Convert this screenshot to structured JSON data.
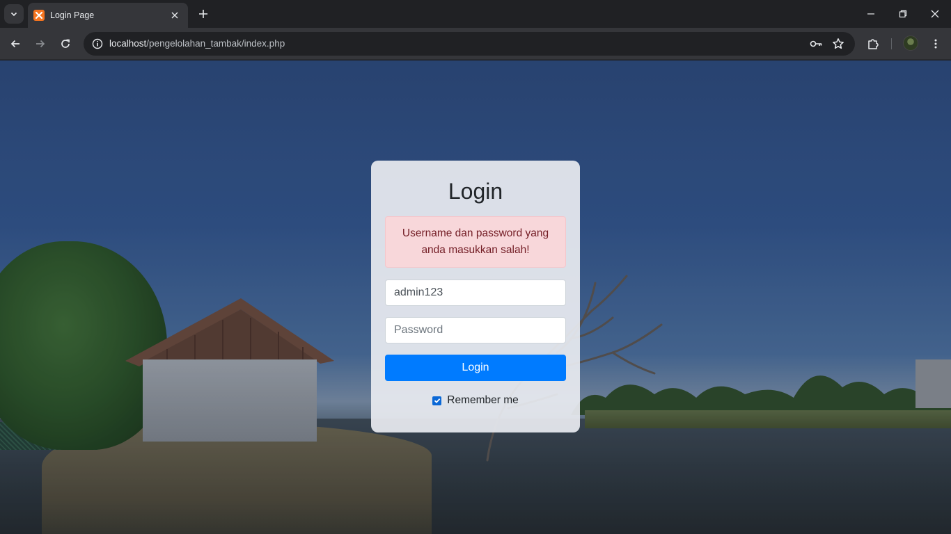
{
  "browser": {
    "tab": {
      "title": "Login Page",
      "favicon": "xampp-icon"
    },
    "url": {
      "host": "localhost",
      "path": "/pengelolahan_tambak/index.php"
    }
  },
  "login": {
    "title": "Login",
    "error": "Username dan password yang anda masukkan salah!",
    "username_value": "admin123",
    "password_placeholder": "Password",
    "submit_label": "Login",
    "remember_label": "Remember me",
    "remember_checked": true
  },
  "colors": {
    "primary": "#007bff",
    "alert_bg": "#f8d7da",
    "alert_text": "#721c24",
    "favicon": "#f5741f"
  }
}
